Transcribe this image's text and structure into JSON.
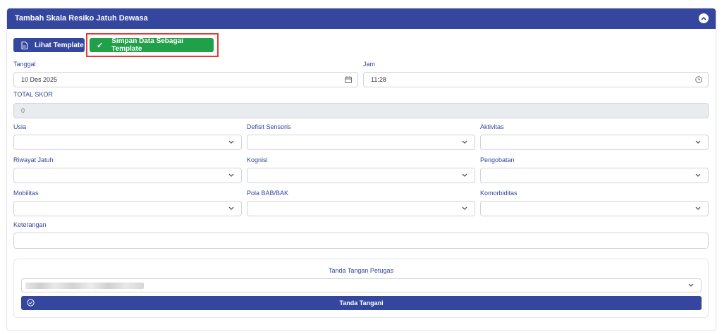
{
  "card": {
    "title": "Tambah Skala Resiko Jatuh Dewasa"
  },
  "toolbar": {
    "lihat_label": "Lihat Template",
    "simpan_label": "Simpan Data Sebagai Template",
    "simpan_icon": "checkmark-icon",
    "lihat_icon": "document-icon"
  },
  "form": {
    "tanggal": {
      "label": "Tanggal",
      "value": "10 Des 2025"
    },
    "jam": {
      "label": "Jam",
      "value": "11:28"
    },
    "total_skor": {
      "label": "TOTAL SKOR",
      "value": "0"
    },
    "usia": {
      "label": "Usia",
      "value": ""
    },
    "defisit": {
      "label": "Defisit Sensoris",
      "value": ""
    },
    "aktivitas": {
      "label": "Aktivitas",
      "value": ""
    },
    "riwayat": {
      "label": "Riwayat Jatuh",
      "value": ""
    },
    "kognisi": {
      "label": "Kognisi",
      "value": ""
    },
    "pengobatan": {
      "label": "Pengobatan",
      "value": ""
    },
    "mobilitas": {
      "label": "Mobilitas",
      "value": ""
    },
    "pola": {
      "label": "Pola BAB/BAK",
      "value": ""
    },
    "komorbiditas": {
      "label": "Komorbiditas",
      "value": ""
    },
    "keterangan": {
      "label": "Keterangan",
      "value": ""
    }
  },
  "signature": {
    "title": "Tanda Tangan Petugas",
    "button_label": "Tanda Tangani"
  },
  "colors": {
    "primary": "#34469e",
    "success": "#20a048",
    "highlight": "#e53935"
  }
}
